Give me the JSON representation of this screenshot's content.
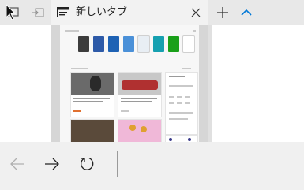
{
  "tab": {
    "title": "新しいタブ"
  },
  "icons": {
    "tab_preview": "tab-preview-icon",
    "set_aside": "set-aside-tabs-icon",
    "close": "close-icon",
    "new_tab": "plus-icon",
    "collapse": "chevron-up-icon",
    "back": "back-arrow-icon",
    "forward": "forward-arrow-icon",
    "refresh": "refresh-icon",
    "page_favicon": "new-tab-favicon-icon"
  },
  "colors": {
    "accent": "#0078d7",
    "tile_colors": [
      "#3c3c3c",
      "#2d5aa8",
      "#1e62b4",
      "#4a90d8",
      "#e8eef4",
      "#16a0b0",
      "#1aa01a"
    ]
  }
}
